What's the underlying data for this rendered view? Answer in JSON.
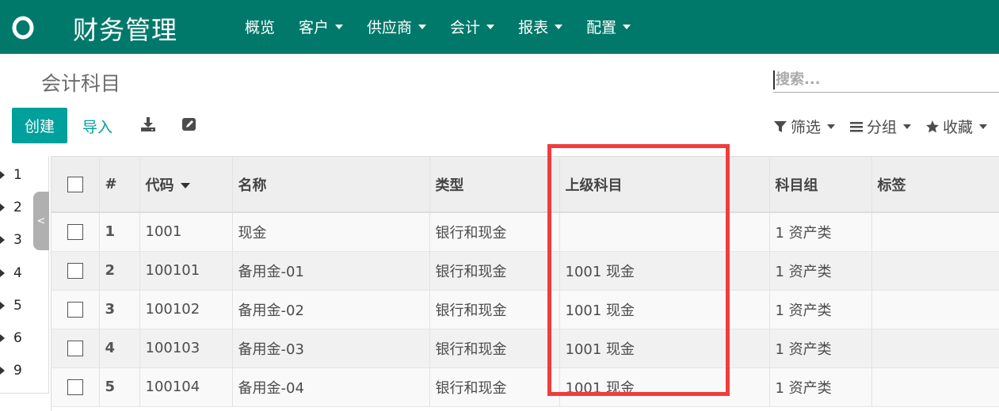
{
  "navbar": {
    "brand": "财务管理",
    "menu": [
      {
        "label": "概览",
        "dropdown": false
      },
      {
        "label": "客户",
        "dropdown": true
      },
      {
        "label": "供应商",
        "dropdown": true
      },
      {
        "label": "会计",
        "dropdown": true
      },
      {
        "label": "报表",
        "dropdown": true
      },
      {
        "label": "配置",
        "dropdown": true
      }
    ],
    "color": "#00796b"
  },
  "control_panel": {
    "title": "会计科目",
    "search_placeholder": "搜索...",
    "create_label": "创建",
    "import_label": "导入",
    "filters": [
      {
        "label": "筛选",
        "icon": "filter-icon"
      },
      {
        "label": "分组",
        "icon": "list-icon"
      },
      {
        "label": "收藏",
        "icon": "star-icon"
      }
    ],
    "accent": "#00a09d"
  },
  "tree": {
    "items": [
      "1",
      "2",
      "3",
      "4",
      "5",
      "6",
      "9"
    ],
    "collapse_label": "<"
  },
  "table": {
    "columns": [
      "#",
      "代码",
      "名称",
      "类型",
      "上级科目",
      "科目组",
      "标签"
    ],
    "sorted_column": "代码",
    "rows": [
      {
        "num": "1",
        "code": "1001",
        "name": "现金",
        "type": "银行和现金",
        "parent": "",
        "group": "1 资产类",
        "tags": ""
      },
      {
        "num": "2",
        "code": "100101",
        "name": "备用金-01",
        "type": "银行和现金",
        "parent": "1001 现金",
        "group": "1 资产类",
        "tags": ""
      },
      {
        "num": "3",
        "code": "100102",
        "name": "备用金-02",
        "type": "银行和现金",
        "parent": "1001 现金",
        "group": "1 资产类",
        "tags": ""
      },
      {
        "num": "4",
        "code": "100103",
        "name": "备用金-03",
        "type": "银行和现金",
        "parent": "1001 现金",
        "group": "1 资产类",
        "tags": ""
      },
      {
        "num": "5",
        "code": "100104",
        "name": "备用金-04",
        "type": "银行和现金",
        "parent": "1001 现金",
        "group": "1 资产类",
        "tags": ""
      }
    ]
  },
  "highlight_color": "#f03c3c"
}
